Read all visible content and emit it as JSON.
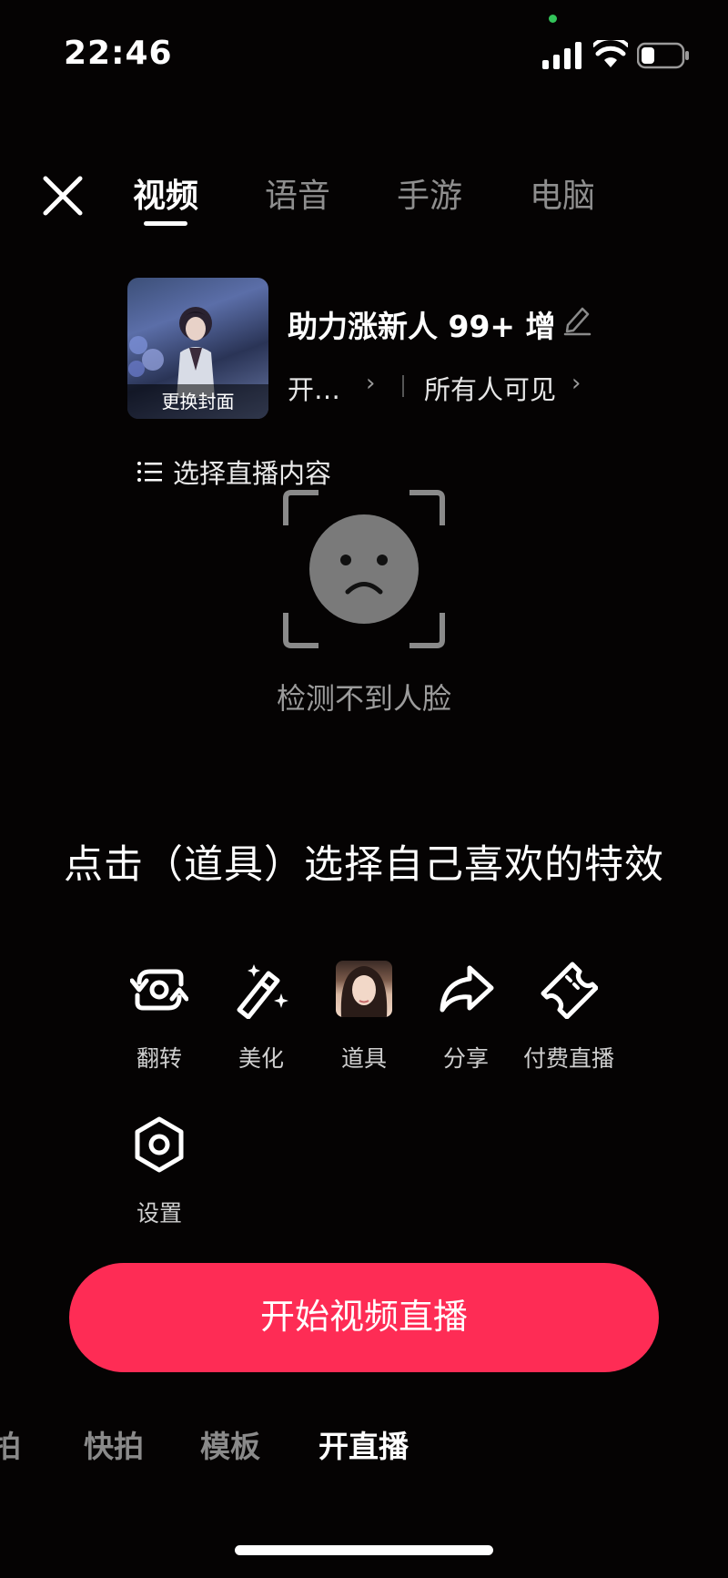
{
  "status_bar": {
    "time": "22:46"
  },
  "top_tabs": [
    {
      "label": "视频",
      "active": true
    },
    {
      "label": "语音",
      "active": false
    },
    {
      "label": "手游",
      "active": false
    },
    {
      "label": "电脑",
      "active": false
    }
  ],
  "cover": {
    "label": "更换封面"
  },
  "live": {
    "title": "助力涨新人 99+ 增",
    "category": "开…",
    "visibility": "所有人可见"
  },
  "select_content": {
    "label": "选择直播内容"
  },
  "face_detect": {
    "message": "检测不到人脸"
  },
  "hint": "点击（道具）选择自己喜欢的特效",
  "tools": [
    {
      "label": "翻转",
      "icon": "flip-camera-icon"
    },
    {
      "label": "美化",
      "icon": "magic-wand-icon"
    },
    {
      "label": "道具",
      "icon": "props-avatar-icon"
    },
    {
      "label": "分享",
      "icon": "share-arrow-icon"
    },
    {
      "label": "付费直播",
      "icon": "ticket-icon"
    },
    {
      "label": "设置",
      "icon": "settings-hexagon-icon"
    }
  ],
  "start_button": {
    "label": "开始视频直播",
    "color": "#fe2c55"
  },
  "bottom_modes": [
    {
      "label": "拍",
      "active": false
    },
    {
      "label": "快拍",
      "active": false
    },
    {
      "label": "模板",
      "active": false
    },
    {
      "label": "开直播",
      "active": true
    }
  ]
}
